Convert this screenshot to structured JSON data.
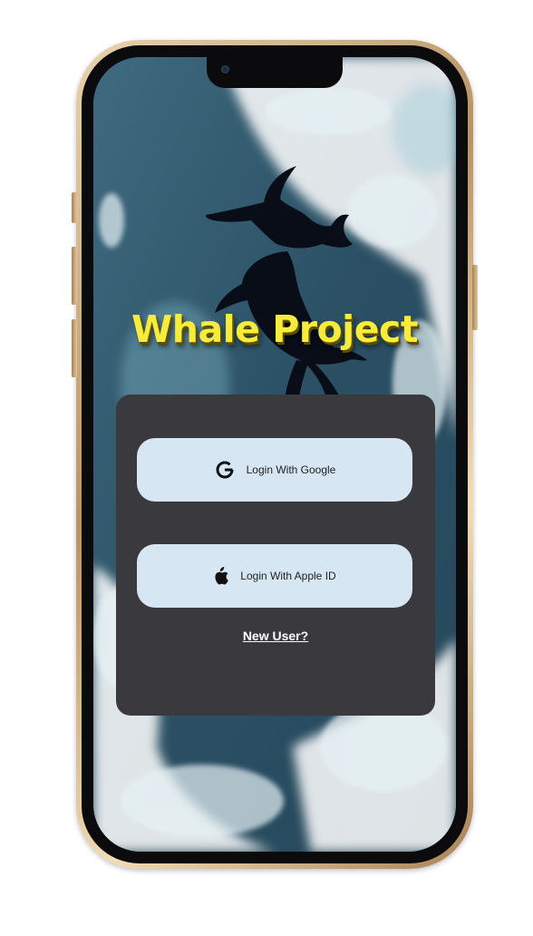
{
  "app": {
    "title": "Whale Project"
  },
  "auth": {
    "google_label": "Login With Google",
    "apple_label": "Login With Apple ID",
    "new_user_label": "New User?"
  },
  "icons": {
    "google": "google-g-icon",
    "apple": "apple-icon",
    "logo": "whale-tail-logo"
  },
  "colors": {
    "title_yellow": "#f7ec3c",
    "card_bg": "#3a3a3e",
    "button_bg": "#d6e6f3",
    "ocean": "#2a4e63"
  }
}
